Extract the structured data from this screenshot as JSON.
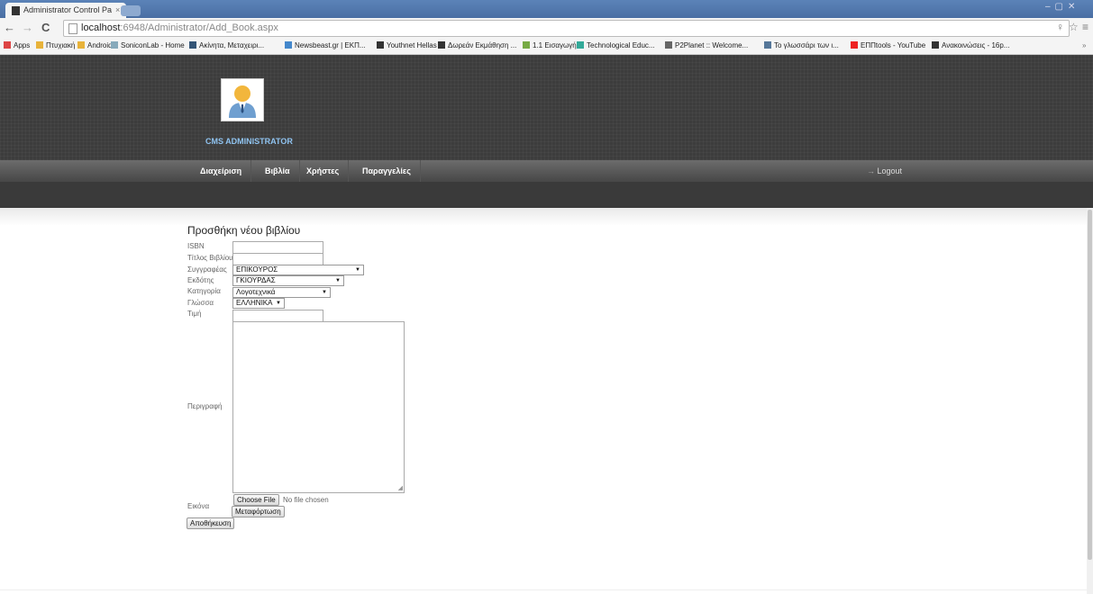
{
  "browser": {
    "tab_title": "Administrator Control Pa",
    "url_host": "localhost",
    "url_rest": ":6948/Administrator/Add_Book.aspx",
    "bookmarks": [
      "Apps",
      "Πτυχιακή",
      "Android",
      "SoniconLab - Home",
      "Ακίνητα, Μεταχειρι...",
      "Newsbeast.gr | ΕΚΠ...",
      "Youthnet Hellas",
      "Δωρεάν Εκμάθηση ...",
      "1.1 Εισαγωγή",
      "Technological Educ...",
      "P2Planet :: Welcome...",
      "Το γλωσσάρι των ι...",
      "ΕΠΠtools - YouTube",
      "Ανακοινώσεις - 16p..."
    ]
  },
  "header": {
    "brand": "CMS ADMINISTRATOR"
  },
  "menu": {
    "items": [
      "Διαχείριση",
      "Βιβλία",
      "Χρήστες",
      "Παραγγελίες"
    ],
    "logout": "Logout"
  },
  "form": {
    "title": "Προσθήκη νέου βιβλίου",
    "labels": {
      "isbn": "ISBN",
      "book_title": "Τίτλος Βιβλίου",
      "author": "Συγγραφέας",
      "publisher": "Εκδότης",
      "category": "Κατηγορία",
      "language": "Γλώσσα",
      "price": "Τιμή",
      "description": "Περιγραφή",
      "image": "Εικόνα"
    },
    "values": {
      "isbn": "",
      "book_title": "",
      "author": "ΕΠΙΚΟΥΡΟΣ",
      "publisher": "ΓΚΙΟΥΡΔΑΣ",
      "category": "Λογοτεχνικά",
      "language": "ΕΛΛΗΝΙΚΑ",
      "price": ""
    },
    "choose_file": "Choose File",
    "no_file": "No file chosen",
    "upload": "Μεταφόρτωση",
    "save": "Αποθήκευση"
  }
}
